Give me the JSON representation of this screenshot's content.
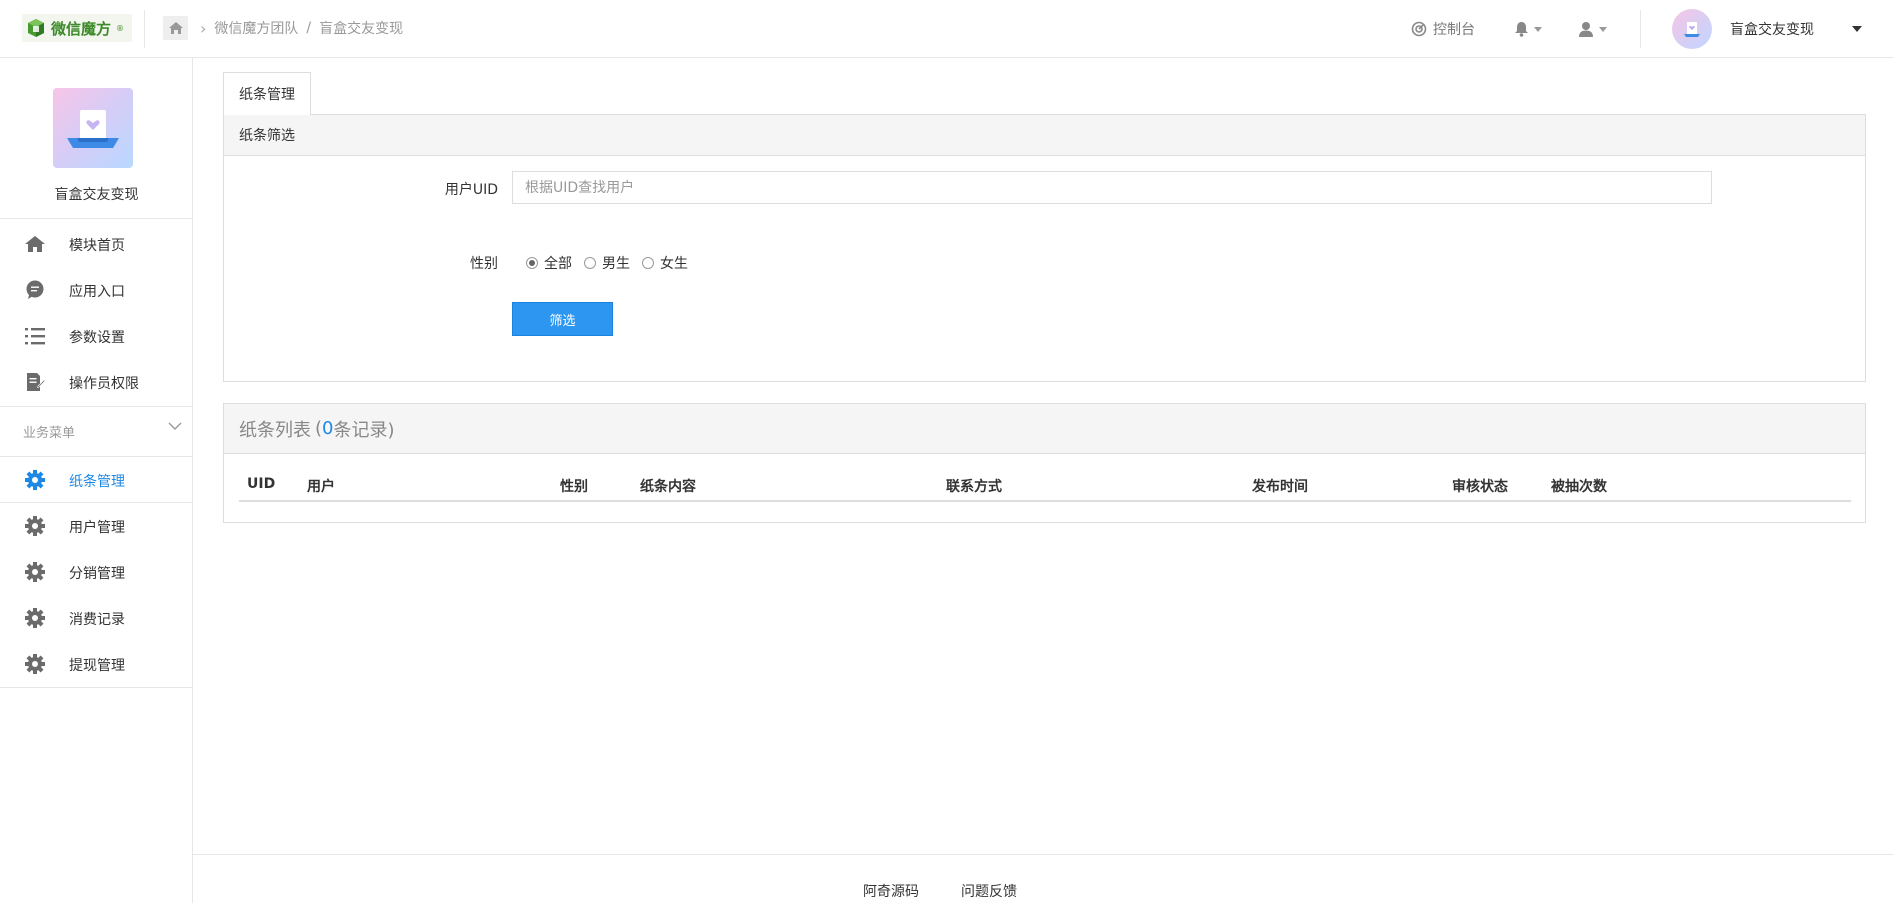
{
  "header": {
    "brand": "微信魔方",
    "brand_mark": "®",
    "breadcrumb_team": "微信魔方团队",
    "breadcrumb_sep": "/",
    "breadcrumb_app": "盲盒交友变现",
    "console_label": "控制台",
    "profile_name": "盲盒交友变现"
  },
  "sidebar": {
    "app_name": "盲盒交友变现",
    "items": [
      {
        "label": "模块首页",
        "icon": "home-icon"
      },
      {
        "label": "应用入口",
        "icon": "chat-icon"
      },
      {
        "label": "参数设置",
        "icon": "list-icon"
      },
      {
        "label": "操作员权限",
        "icon": "edit-doc-icon"
      }
    ],
    "section_label": "业务菜单",
    "business_items": [
      {
        "label": "纸条管理",
        "icon": "gear-icon",
        "active": true
      },
      {
        "label": "用户管理",
        "icon": "gear-icon"
      },
      {
        "label": "分销管理",
        "icon": "gear-icon"
      },
      {
        "label": "消费记录",
        "icon": "gear-icon"
      },
      {
        "label": "提现管理",
        "icon": "gear-icon"
      }
    ]
  },
  "main": {
    "tab_label": "纸条管理",
    "filter_panel_title": "纸条筛选",
    "uid_label": "用户UID",
    "uid_placeholder": "根据UID查找用户",
    "uid_value": "",
    "gender_label": "性别",
    "gender_options": [
      "全部",
      "男生",
      "女生"
    ],
    "gender_selected": "全部",
    "filter_button": "筛选",
    "list_title": "纸条列表",
    "list_count_open": "(",
    "list_count": "0",
    "list_count_suffix": "条记录)",
    "columns": [
      "UID",
      "用户",
      "性别",
      "纸条内容",
      "联系方式",
      "发布时间",
      "审核状态",
      "被抽次数"
    ]
  },
  "footer": {
    "links": [
      "阿奇源码",
      "问题反馈"
    ]
  },
  "colors": {
    "accent": "#1e88e5",
    "button": "#2d96f1",
    "brand_green": "#3d8a2a"
  }
}
